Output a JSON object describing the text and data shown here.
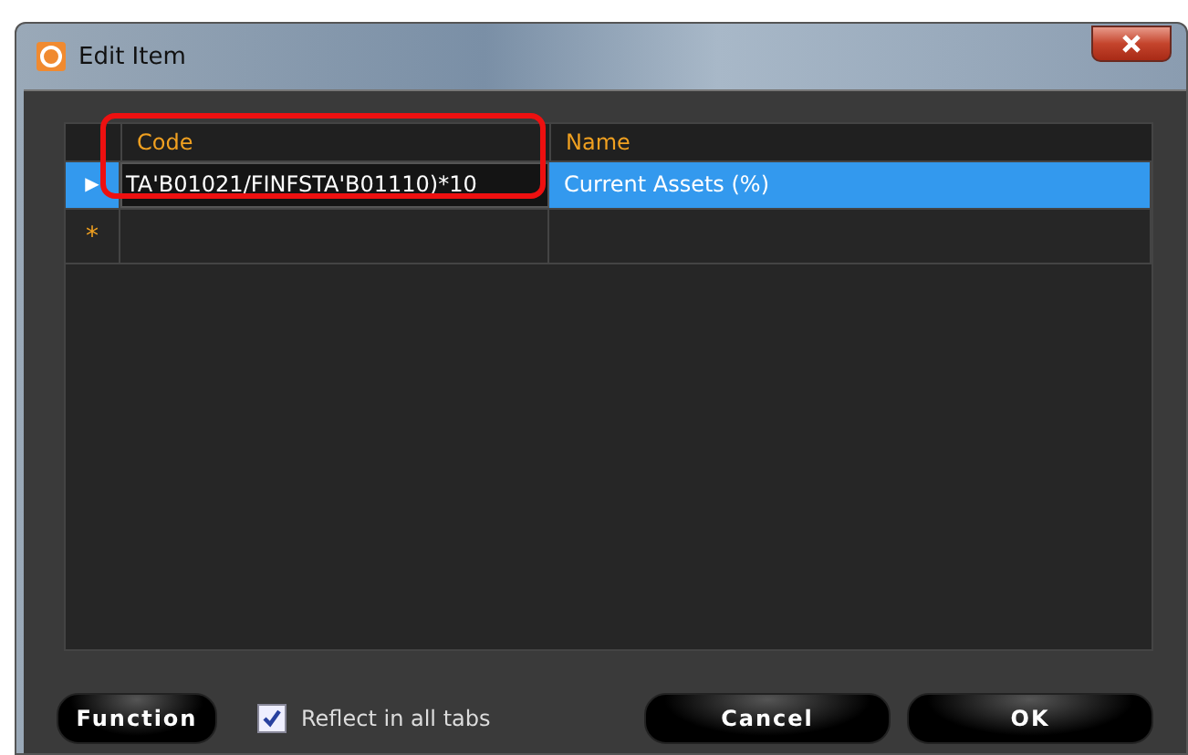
{
  "window": {
    "title": "Edit Item"
  },
  "table": {
    "columns": [
      "Code",
      "Name"
    ],
    "rows": [
      {
        "selected": true,
        "editing": true,
        "marker": "▶",
        "cells": [
          "TA'B01021/FINFSTA'B01110)*10",
          "Current Assets (%)"
        ]
      },
      {
        "selected": false,
        "editing": false,
        "marker": "*",
        "cells": [
          "",
          ""
        ]
      }
    ]
  },
  "annotation": {
    "kind": "highlight"
  },
  "function_button": "Function",
  "reflect_checkbox": {
    "label": "Reflect in all tabs",
    "checked": true
  },
  "buttons": [
    "Cancel",
    "OK"
  ]
}
